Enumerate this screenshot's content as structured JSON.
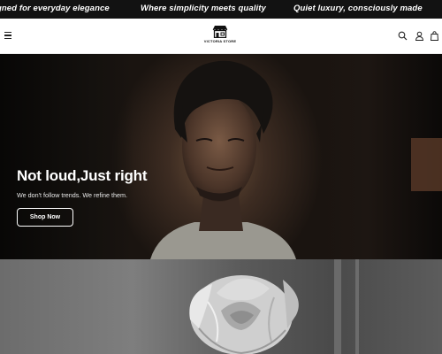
{
  "announcement": {
    "messages": [
      "gned for everyday elegance",
      "Where simplicity meets quality",
      "Quiet luxury, consciously made"
    ]
  },
  "header": {
    "logo_text": "VICTORIA STORE",
    "icons": {
      "menu": "hamburger-icon",
      "search": "search-icon",
      "account": "account-icon",
      "cart": "cart-icon"
    }
  },
  "hero": {
    "title": "Not loud,Just right",
    "subtitle": "We don't follow trends. We refine them.",
    "button_label": "Shop Now"
  },
  "colors": {
    "announcement_bg": "#121212",
    "header_bg": "#ffffff",
    "text_dark": "#111111",
    "hero_text": "#ffffff"
  }
}
